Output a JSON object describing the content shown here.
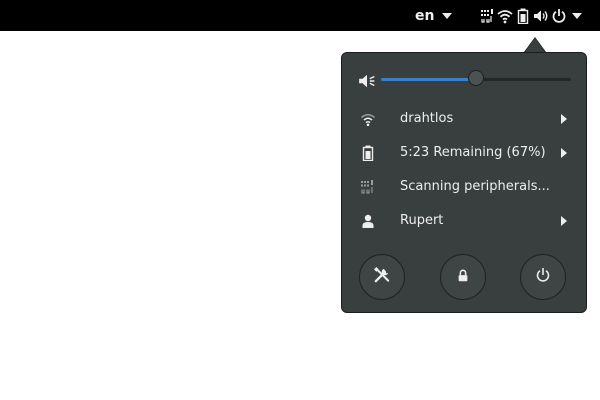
{
  "topbar": {
    "language": "en",
    "icons": [
      "network-peripheral-icon",
      "wifi-icon",
      "battery-icon",
      "volume-icon",
      "power-icon",
      "chevron-down-icon"
    ]
  },
  "system_menu": {
    "volume": {
      "icon": "volume-low-icon",
      "level": 0.5
    },
    "items": [
      {
        "icon": "wifi-icon",
        "label": "drahtlos",
        "has_submenu": true
      },
      {
        "icon": "battery-icon",
        "label": "5:23 Remaining (67%)",
        "has_submenu": true
      },
      {
        "icon": "peripheral-icon",
        "label": "Scanning peripherals...",
        "has_submenu": false
      },
      {
        "icon": "user-icon",
        "label": "Rupert",
        "has_submenu": true
      }
    ],
    "buttons": [
      {
        "icon": "settings-tools-icon"
      },
      {
        "icon": "lock-icon"
      },
      {
        "icon": "power-icon"
      }
    ]
  },
  "colors": {
    "topbar_bg": "#000000",
    "menu_bg": "#393f3f",
    "accent": "#3d7fc7",
    "text": "#eeeeec"
  }
}
